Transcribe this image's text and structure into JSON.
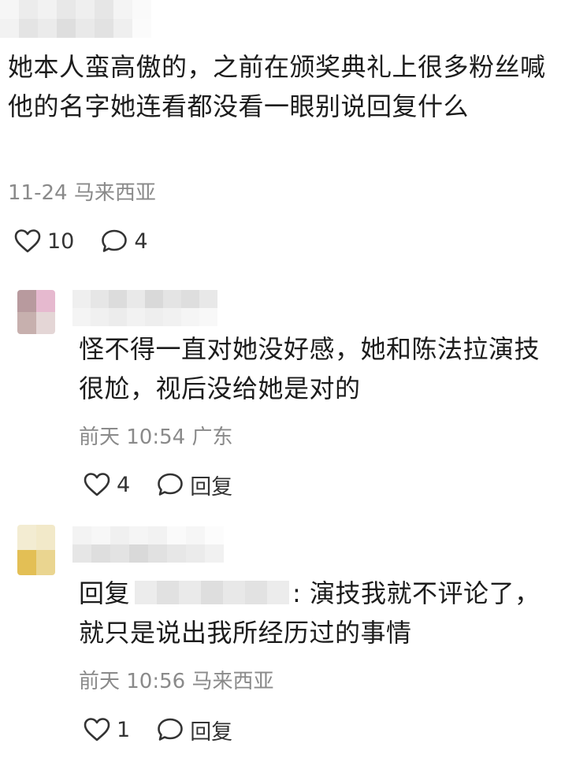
{
  "main_comment": {
    "body": "她本人蛮高傲的，之前在颁奖典礼上很多粉丝喊他的名字她连看都没看一眼别说回复什么",
    "meta": "11-24 马来西亚",
    "like_count": "10",
    "reply_count": "4"
  },
  "replies": [
    {
      "body": "怪不得一直对她没好感，她和陈法拉演技很尬，视后没给她是对的",
      "meta": "前天 10:54 广东",
      "like_count": "4",
      "reply_label": "回复"
    },
    {
      "reply_prefix": "回复",
      "body": ": 演技我就不评论了，就只是说出我所经历过的事情",
      "meta": "前天 10:56 马来西亚",
      "like_count": "1",
      "reply_label": "回复"
    }
  ],
  "icons": {
    "like": "heart-outline-icon",
    "comment": "speech-bubble-icon"
  },
  "colors": {
    "text_primary": "#1c1c1c",
    "text_meta": "#8a8a8a",
    "blur_light": "#ececec",
    "blur_mid": "#dcdcdc"
  }
}
